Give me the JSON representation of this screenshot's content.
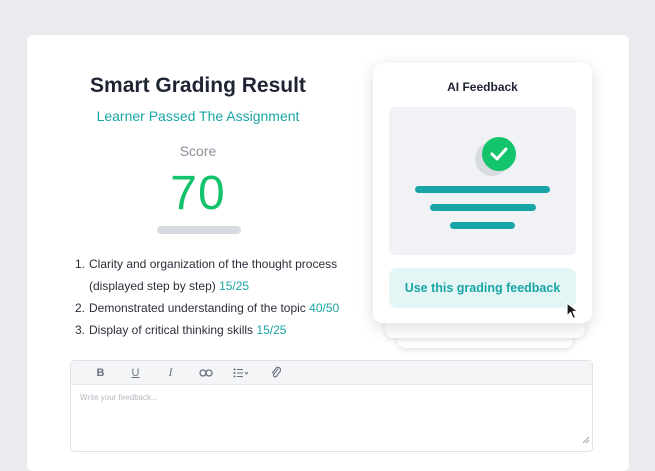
{
  "result": {
    "title": "Smart Grading Result",
    "subtitle": "Learner Passed The Assignment",
    "score_label": "Score",
    "score_value": "70"
  },
  "criteria": [
    {
      "num": "1.",
      "text": "Clarity and organization of the thought process",
      "text2": "(displayed step by step)",
      "score": "15/25"
    },
    {
      "num": "2.",
      "text": "Demonstrated understanding of the topic",
      "score": "40/50"
    },
    {
      "num": "3.",
      "text": "Display of critical thinking skills",
      "score": "15/25"
    }
  ],
  "ai_feedback": {
    "title": "AI Feedback",
    "button_label": "Use this grading feedback"
  },
  "editor": {
    "placeholder": "Write your feedback...",
    "toolbar": [
      "bold-icon",
      "underline-icon",
      "italic-icon",
      "link-icon",
      "list-icon",
      "attachment-icon"
    ]
  },
  "colors": {
    "accent_teal": "#19a5a5",
    "score_green": "#13c46c",
    "title_dark": "#1f2433"
  }
}
